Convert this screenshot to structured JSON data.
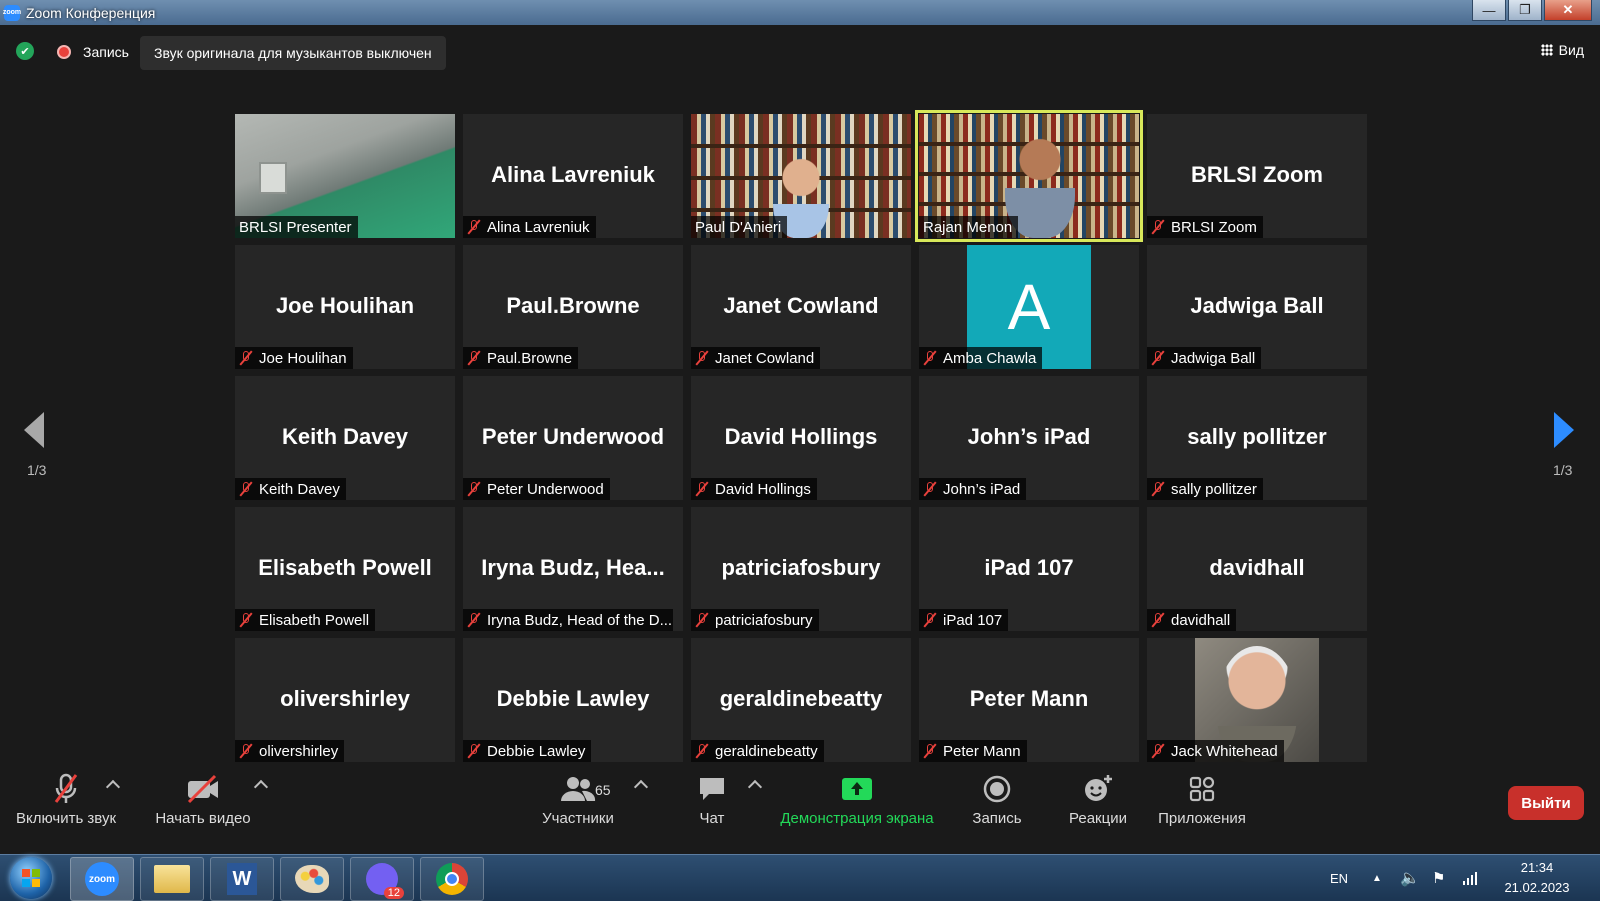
{
  "window": {
    "title": "Zoom Конференция",
    "minimize": "—",
    "maximize": "❐",
    "close": "✕"
  },
  "topbar": {
    "record_label": "Запись",
    "musician_audio": "Звук оригинала для музыкантов выключен",
    "view_label": "Вид"
  },
  "pages": {
    "left": "1/3",
    "right": "1/3"
  },
  "participants": [
    {
      "name": "BRLSI Presenter",
      "big": "",
      "muted": false,
      "video": "room"
    },
    {
      "name": "Alina Lavreniuk",
      "big": "Alina Lavreniuk",
      "muted": true
    },
    {
      "name": "Paul D'Anieri",
      "big": "",
      "muted": false,
      "video": "books"
    },
    {
      "name": "Rajan Menon",
      "big": "",
      "muted": false,
      "video": "books2",
      "active": true
    },
    {
      "name": "BRLSI Zoom",
      "big": "BRLSI Zoom",
      "muted": true
    },
    {
      "name": "Joe Houlihan",
      "big": "Joe Houlihan",
      "muted": true
    },
    {
      "name": "Paul.Browne",
      "big": "Paul.Browne",
      "muted": true
    },
    {
      "name": "Janet Cowland",
      "big": "Janet Cowland",
      "muted": true
    },
    {
      "name": "Amba Chawla",
      "big": "",
      "muted": true,
      "avatar_letter": "A"
    },
    {
      "name": "Jadwiga Ball",
      "big": "Jadwiga Ball",
      "muted": true
    },
    {
      "name": "Keith Davey",
      "big": "Keith Davey",
      "muted": true
    },
    {
      "name": "Peter Underwood",
      "big": "Peter Underwood",
      "muted": true
    },
    {
      "name": "David Hollings",
      "big": "David Hollings",
      "muted": true
    },
    {
      "name": "John’s iPad",
      "big": "John’s iPad",
      "muted": true
    },
    {
      "name": "sally pollitzer",
      "big": "sally pollitzer",
      "muted": true
    },
    {
      "name": "Elisabeth Powell",
      "big": "Elisabeth Powell",
      "muted": true
    },
    {
      "name": "Iryna Budz, Head of the D...",
      "big": "Iryna Budz, Hea...",
      "muted": true
    },
    {
      "name": "patriciafosbury",
      "big": "patriciafosbury",
      "muted": true
    },
    {
      "name": "iPad 107",
      "big": "iPad 107",
      "muted": true
    },
    {
      "name": "davidhall",
      "big": "davidhall",
      "muted": true
    },
    {
      "name": "olivershirley",
      "big": "olivershirley",
      "muted": true
    },
    {
      "name": "Debbie Lawley",
      "big": "Debbie Lawley",
      "muted": true
    },
    {
      "name": "geraldinebeatty",
      "big": "geraldinebeatty",
      "muted": true
    },
    {
      "name": "Peter Mann",
      "big": "Peter Mann",
      "muted": true
    },
    {
      "name": "Jack Whitehead",
      "big": "",
      "muted": true,
      "video": "old"
    }
  ],
  "toolbar": {
    "unmute": "Включить звук",
    "start_video": "Начать видео",
    "participants": "Участники",
    "participants_count": "65",
    "chat": "Чат",
    "share": "Демонстрация экрана",
    "record": "Запись",
    "reactions": "Реакции",
    "apps": "Приложения",
    "leave": "Выйти"
  },
  "taskbar": {
    "zoom_app": "zoom",
    "word_app": "W",
    "viber_badge": "12",
    "lang": "EN",
    "time": "21:34",
    "date": "21.02.2023"
  },
  "colors": {
    "accent": "#2d8cff",
    "share_green": "#23d959",
    "leave_red": "#c8302b",
    "active_speaker": "#d8e85a",
    "avatar_teal": "#12a9b8"
  }
}
